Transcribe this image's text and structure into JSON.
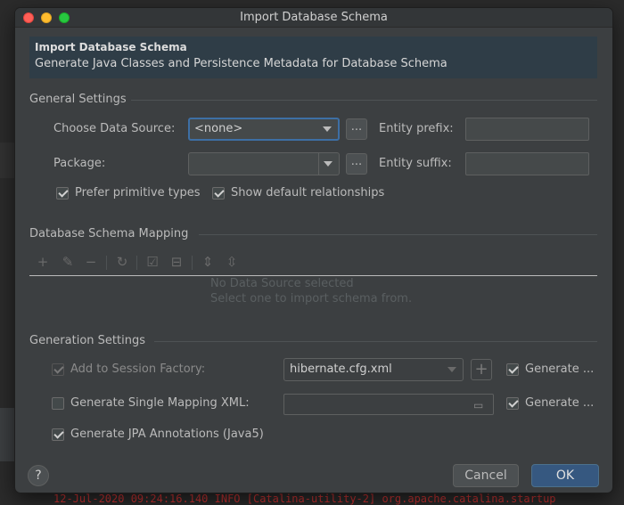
{
  "dialog": {
    "title": "Import Database Schema",
    "banner_title": "Import Database Schema",
    "banner_subtitle": "Generate Java Classes and Persistence Metadata for Database Schema"
  },
  "general": {
    "section_title": "General Settings",
    "data_source_label": "Choose Data Source:",
    "data_source_value": "<none>",
    "ellipsis": "...",
    "entity_prefix_label": "Entity prefix:",
    "entity_prefix_value": "",
    "package_label": "Package:",
    "package_value": "",
    "entity_suffix_label": "Entity suffix:",
    "entity_suffix_value": "",
    "prefer_primitive_label": "Prefer primitive types",
    "prefer_primitive_checked": true,
    "show_relationships_label": "Show default relationships",
    "show_relationships_checked": true
  },
  "mapping": {
    "section_title": "Database Schema Mapping",
    "toolbar_icons": [
      "plus-icon",
      "pencil-icon",
      "minus-icon",
      "refresh-icon",
      "check-all-icon",
      "uncheck-all-icon",
      "expand-all-icon",
      "collapse-all-icon"
    ],
    "empty_line1": "No Data Source selected",
    "empty_line2": "Select one to import schema from."
  },
  "generation": {
    "section_title": "Generation Settings",
    "session_factory_label": "Add to Session Factory:",
    "session_factory_checked": true,
    "session_factory_value": "hibernate.cfg.xml",
    "generate_label_1": "Generate ...",
    "generate_checked_1": true,
    "single_mapping_label": "Generate Single Mapping XML:",
    "single_mapping_checked": false,
    "single_mapping_value": "",
    "generate_label_2": "Generate ...",
    "generate_checked_2": true,
    "jpa_label": "Generate JPA Annotations (Java5)",
    "jpa_checked": true
  },
  "footer": {
    "help": "?",
    "cancel": "Cancel",
    "ok": "OK"
  },
  "background": {
    "log_text": "12-Jul-2020 09:24:16.140 INFO [Catalina-utility-2] org.apache.catalina.startup"
  },
  "colors": {
    "dialog_bg": "#3c3f41",
    "banner_bg": "#2f3d47",
    "accent": "#365880",
    "focus": "#3d6fa5"
  }
}
